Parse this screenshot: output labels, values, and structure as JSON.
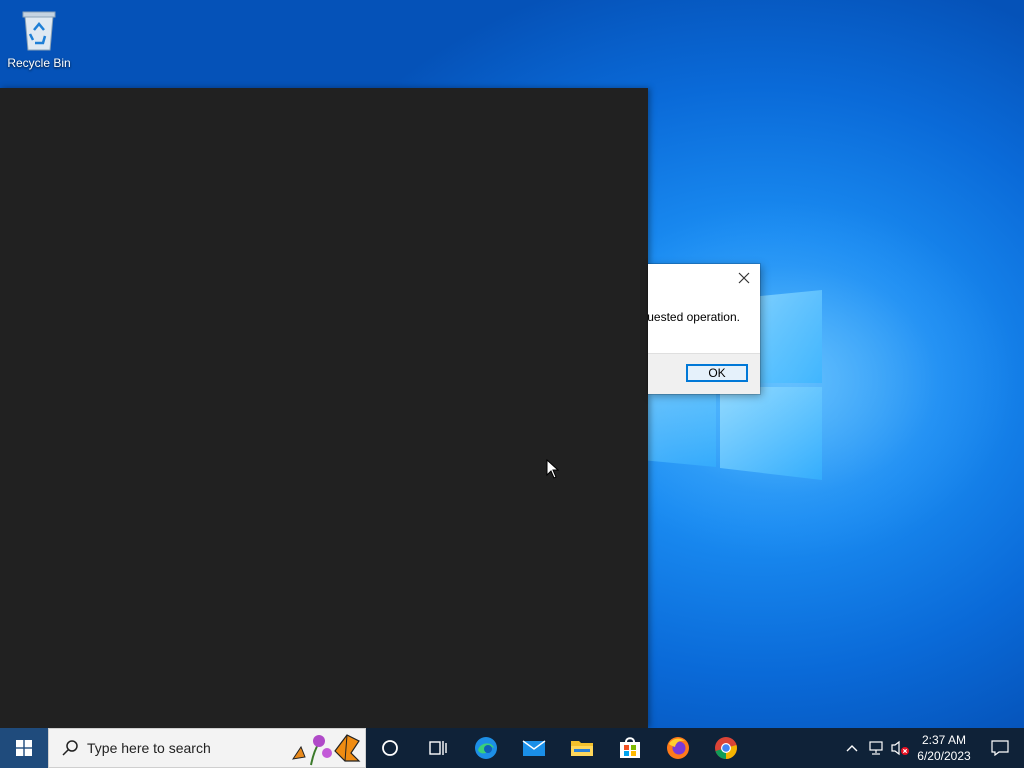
{
  "desktop": {
    "icons": [
      {
        "label": "Recycle Bin",
        "icon": "recycle-bin-icon"
      }
    ]
  },
  "dialog": {
    "message_visible": "uested operation.",
    "ok_label": "OK"
  },
  "taskbar": {
    "search_placeholder": "Type here to search",
    "pinned": [
      {
        "name": "cortana",
        "icon": "cortana-circle-icon"
      },
      {
        "name": "task-view",
        "icon": "task-view-icon"
      },
      {
        "name": "edge",
        "icon": "edge-icon"
      },
      {
        "name": "mail",
        "icon": "mail-icon"
      },
      {
        "name": "file-explorer",
        "icon": "folder-icon"
      },
      {
        "name": "store",
        "icon": "store-icon"
      },
      {
        "name": "firefox",
        "icon": "firefox-icon"
      },
      {
        "name": "chrome",
        "icon": "chrome-icon"
      }
    ],
    "clock": {
      "time": "2:37 AM",
      "date": "6/20/2023"
    }
  },
  "colors": {
    "accent": "#0078d7",
    "taskbar_bg": "#0f2238",
    "dark_window": "#212121"
  }
}
